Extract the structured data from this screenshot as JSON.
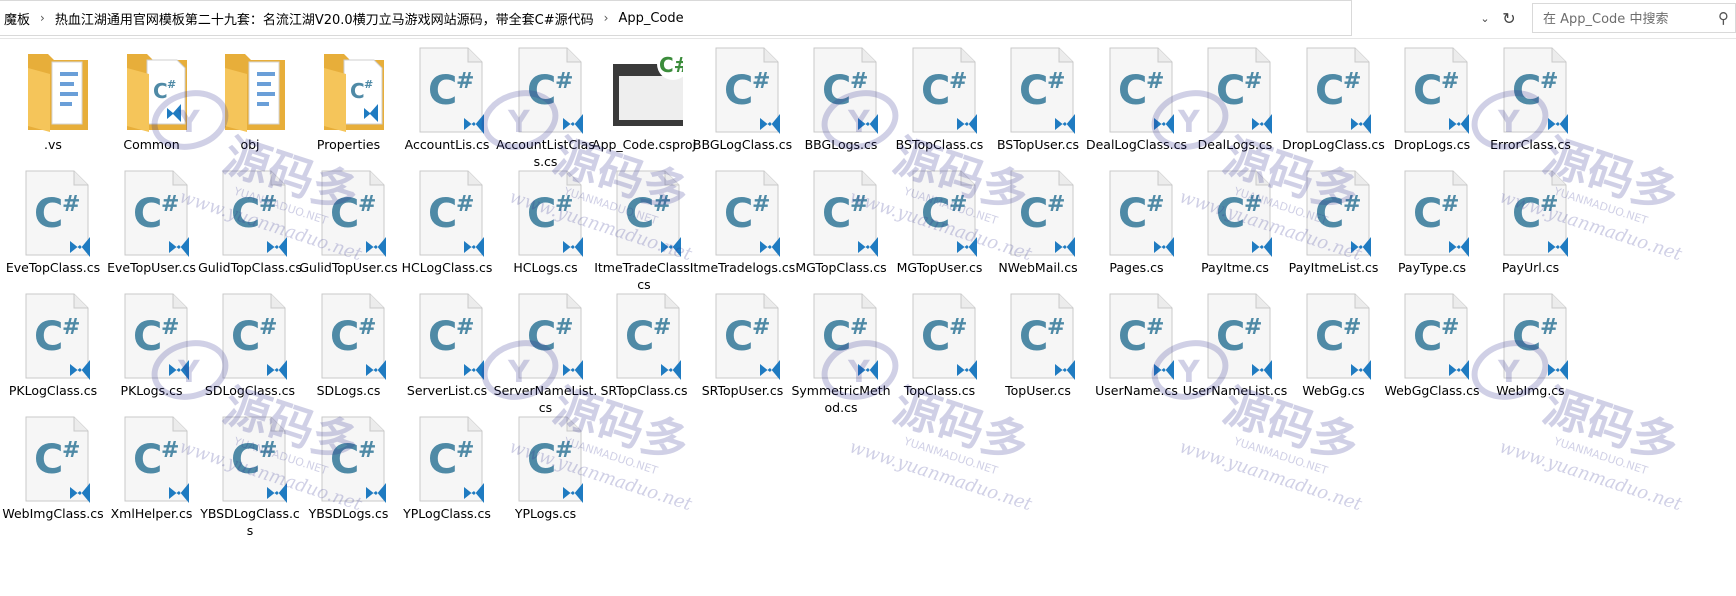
{
  "breadcrumb": {
    "items": [
      "魔板",
      "热血江湖通用官网模板第二十九套：名流江湖V20.0横刀立马游戏网站源码，带全套C#源代码",
      "App_Code"
    ],
    "separator": "›"
  },
  "toolbar": {
    "history_dropdown_icon": "chevron-down-icon",
    "refresh_icon": "refresh-icon",
    "search_placeholder": "在 App_Code 中搜索",
    "search_icon": "search-icon"
  },
  "files": [
    {
      "name": ".vs",
      "kind": "folder"
    },
    {
      "name": "Common",
      "kind": "folder-cs"
    },
    {
      "name": "obj",
      "kind": "folder"
    },
    {
      "name": "Properties",
      "kind": "folder-cs"
    },
    {
      "name": "AccountLis.cs",
      "kind": "cs"
    },
    {
      "name": "AccountListClass.cs",
      "kind": "cs"
    },
    {
      "name": "App_Code.csproj",
      "kind": "csproj"
    },
    {
      "name": "BBGLogClass.cs",
      "kind": "cs"
    },
    {
      "name": "BBGLogs.cs",
      "kind": "cs"
    },
    {
      "name": "BSTopClass.cs",
      "kind": "cs"
    },
    {
      "name": "BSTopUser.cs",
      "kind": "cs"
    },
    {
      "name": "DealLogClass.cs",
      "kind": "cs"
    },
    {
      "name": "DealLogs.cs",
      "kind": "cs"
    },
    {
      "name": "DropLogClass.cs",
      "kind": "cs"
    },
    {
      "name": "DropLogs.cs",
      "kind": "cs"
    },
    {
      "name": "ErrorClass.cs",
      "kind": "cs"
    },
    {
      "name": "EveTopClass.cs",
      "kind": "cs"
    },
    {
      "name": "EveTopUser.cs",
      "kind": "cs"
    },
    {
      "name": "GulidTopClass.cs",
      "kind": "cs"
    },
    {
      "name": "GulidTopUser.cs",
      "kind": "cs"
    },
    {
      "name": "HCLogClass.cs",
      "kind": "cs"
    },
    {
      "name": "HCLogs.cs",
      "kind": "cs"
    },
    {
      "name": "ItmeTradeClass.cs",
      "kind": "cs"
    },
    {
      "name": "ItmeTradelogs.cs",
      "kind": "cs"
    },
    {
      "name": "MGTopClass.cs",
      "kind": "cs"
    },
    {
      "name": "MGTopUser.cs",
      "kind": "cs"
    },
    {
      "name": "NWebMail.cs",
      "kind": "cs"
    },
    {
      "name": "Pages.cs",
      "kind": "cs"
    },
    {
      "name": "PayItme.cs",
      "kind": "cs"
    },
    {
      "name": "PayItmeList.cs",
      "kind": "cs"
    },
    {
      "name": "PayType.cs",
      "kind": "cs"
    },
    {
      "name": "PayUrl.cs",
      "kind": "cs"
    },
    {
      "name": "PKLogClass.cs",
      "kind": "cs"
    },
    {
      "name": "PKLogs.cs",
      "kind": "cs"
    },
    {
      "name": "SDLogClass.cs",
      "kind": "cs"
    },
    {
      "name": "SDLogs.cs",
      "kind": "cs"
    },
    {
      "name": "ServerList.cs",
      "kind": "cs"
    },
    {
      "name": "ServerNameList.cs",
      "kind": "cs"
    },
    {
      "name": "SRTopClass.cs",
      "kind": "cs"
    },
    {
      "name": "SRTopUser.cs",
      "kind": "cs"
    },
    {
      "name": "SymmetricMethod.cs",
      "kind": "cs"
    },
    {
      "name": "TopClass.cs",
      "kind": "cs"
    },
    {
      "name": "TopUser.cs",
      "kind": "cs"
    },
    {
      "name": "UserName.cs",
      "kind": "cs"
    },
    {
      "name": "UserNameList.cs",
      "kind": "cs"
    },
    {
      "name": "WebGg.cs",
      "kind": "cs"
    },
    {
      "name": "WebGgClass.cs",
      "kind": "cs"
    },
    {
      "name": "WebImg.cs",
      "kind": "cs"
    },
    {
      "name": "WebImgClass.cs",
      "kind": "cs"
    },
    {
      "name": "XmlHelper.cs",
      "kind": "cs"
    },
    {
      "name": "YBSDLogClass.cs",
      "kind": "cs"
    },
    {
      "name": "YBSDLogs.cs",
      "kind": "cs"
    },
    {
      "name": "YPLogClass.cs",
      "kind": "cs"
    },
    {
      "name": "YPLogs.cs",
      "kind": "cs"
    }
  ],
  "watermark": {
    "brand": "源码多",
    "url": "www.yuanmaduo.net",
    "sub": "YUANMADUO.NET",
    "color": "#2d2d8f"
  },
  "colors": {
    "cs_icon": "#4f8aa6",
    "vs_badge": "#1f7bc1",
    "folder": "#f5c55a",
    "folder_dark": "#e7ae3a",
    "csproj_badge": "#3b8c3b",
    "csproj_frame": "#3a3a3a"
  }
}
